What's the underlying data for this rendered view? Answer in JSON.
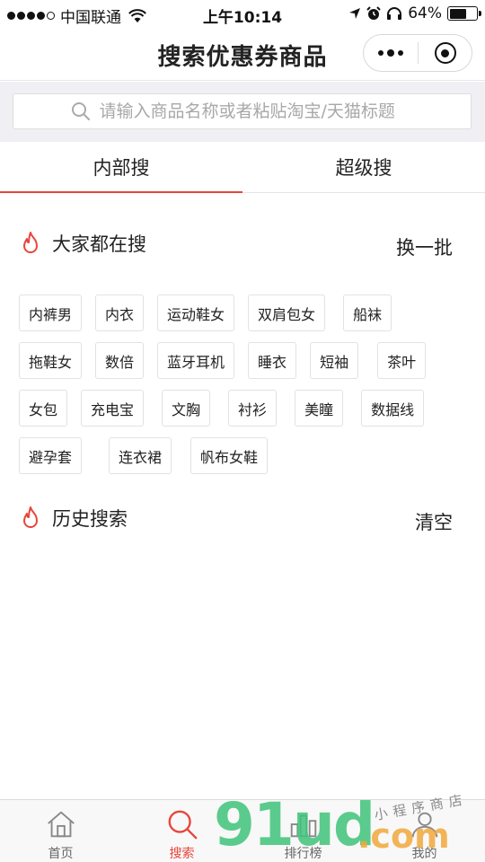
{
  "status_bar": {
    "carrier": "中国联通",
    "time": "上午10:14",
    "battery": "64%",
    "battery_level": 0.64
  },
  "nav": {
    "title": "搜索优惠券商品"
  },
  "search": {
    "placeholder": "请输入商品名称或者粘贴淘宝/天猫标题"
  },
  "tabs": [
    {
      "label": "内部搜",
      "active": true
    },
    {
      "label": "超级搜",
      "active": false
    }
  ],
  "hot_section": {
    "title": "大家都在搜",
    "action": "换一批",
    "tags": [
      [
        "内裤男",
        "内衣",
        "运动鞋女",
        "双肩包女",
        "船袜"
      ],
      [
        "拖鞋女",
        "数倍",
        "蓝牙耳机",
        "睡衣",
        "短袖",
        "茶叶"
      ],
      [
        "女包",
        "充电宝",
        "文胸",
        "衬衫",
        "美瞳",
        "数据线"
      ],
      [
        "避孕套",
        "连衣裙",
        "帆布女鞋"
      ]
    ]
  },
  "history_section": {
    "title": "历史搜索",
    "action": "清空"
  },
  "tab_bar": [
    {
      "label": "首页",
      "icon": "home-icon",
      "active": false
    },
    {
      "label": "搜索",
      "icon": "search-icon",
      "active": true
    },
    {
      "label": "排行榜",
      "icon": "ranking-icon",
      "active": false
    },
    {
      "label": "我的",
      "icon": "user-icon",
      "active": false
    }
  ],
  "colors": {
    "accent": "#e8453c",
    "background": "#efeff4"
  },
  "watermark": {
    "brand": "91ud",
    "suffix": ".com",
    "slogan": "小程序商店"
  }
}
